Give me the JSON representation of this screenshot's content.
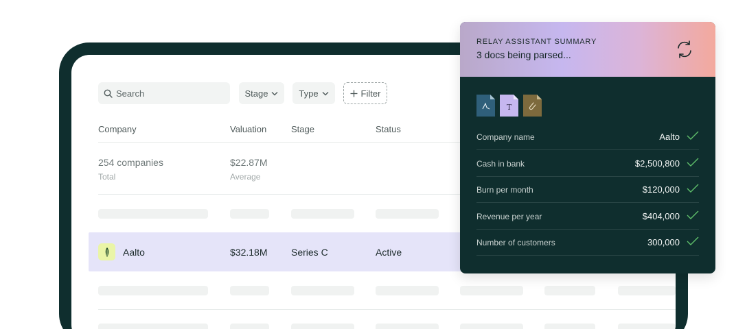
{
  "toolbar": {
    "search_placeholder": "Search",
    "stage_label": "Stage",
    "type_label": "Type",
    "filter_label": "Filter"
  },
  "table": {
    "columns": [
      "Company",
      "Valuation",
      "Stage",
      "Status"
    ],
    "summary": {
      "companies": "254 companies",
      "companies_sub": "Total",
      "valuation": "$22.87M",
      "valuation_sub": "Average"
    },
    "active_row": {
      "company": "Aalto",
      "valuation": "$32.18M",
      "stage": "Series C",
      "status": "Active"
    }
  },
  "assistant": {
    "kicker": "RELAY ASSISTANT SUMMARY",
    "title": "3 docs being parsed...",
    "documents": [
      {
        "icon": "pdf-icon",
        "color": "#2f5f7a"
      },
      {
        "icon": "text-doc-icon",
        "color": "#c6b7ef",
        "glyph": "T"
      },
      {
        "icon": "attachment-icon",
        "color": "#7d6a3d"
      }
    ],
    "fields": [
      {
        "label": "Company name",
        "value": "Aalto"
      },
      {
        "label": "Cash in bank",
        "value": "$2,500,800"
      },
      {
        "label": "Burn per month",
        "value": "$120,000"
      },
      {
        "label": "Revenue per year",
        "value": "$404,000"
      },
      {
        "label": "Number of customers",
        "value": "300,000"
      }
    ]
  },
  "colors": {
    "frame": "#0f2e2e",
    "highlight_row": "#e5e4f9",
    "check": "#5fbf6b"
  }
}
